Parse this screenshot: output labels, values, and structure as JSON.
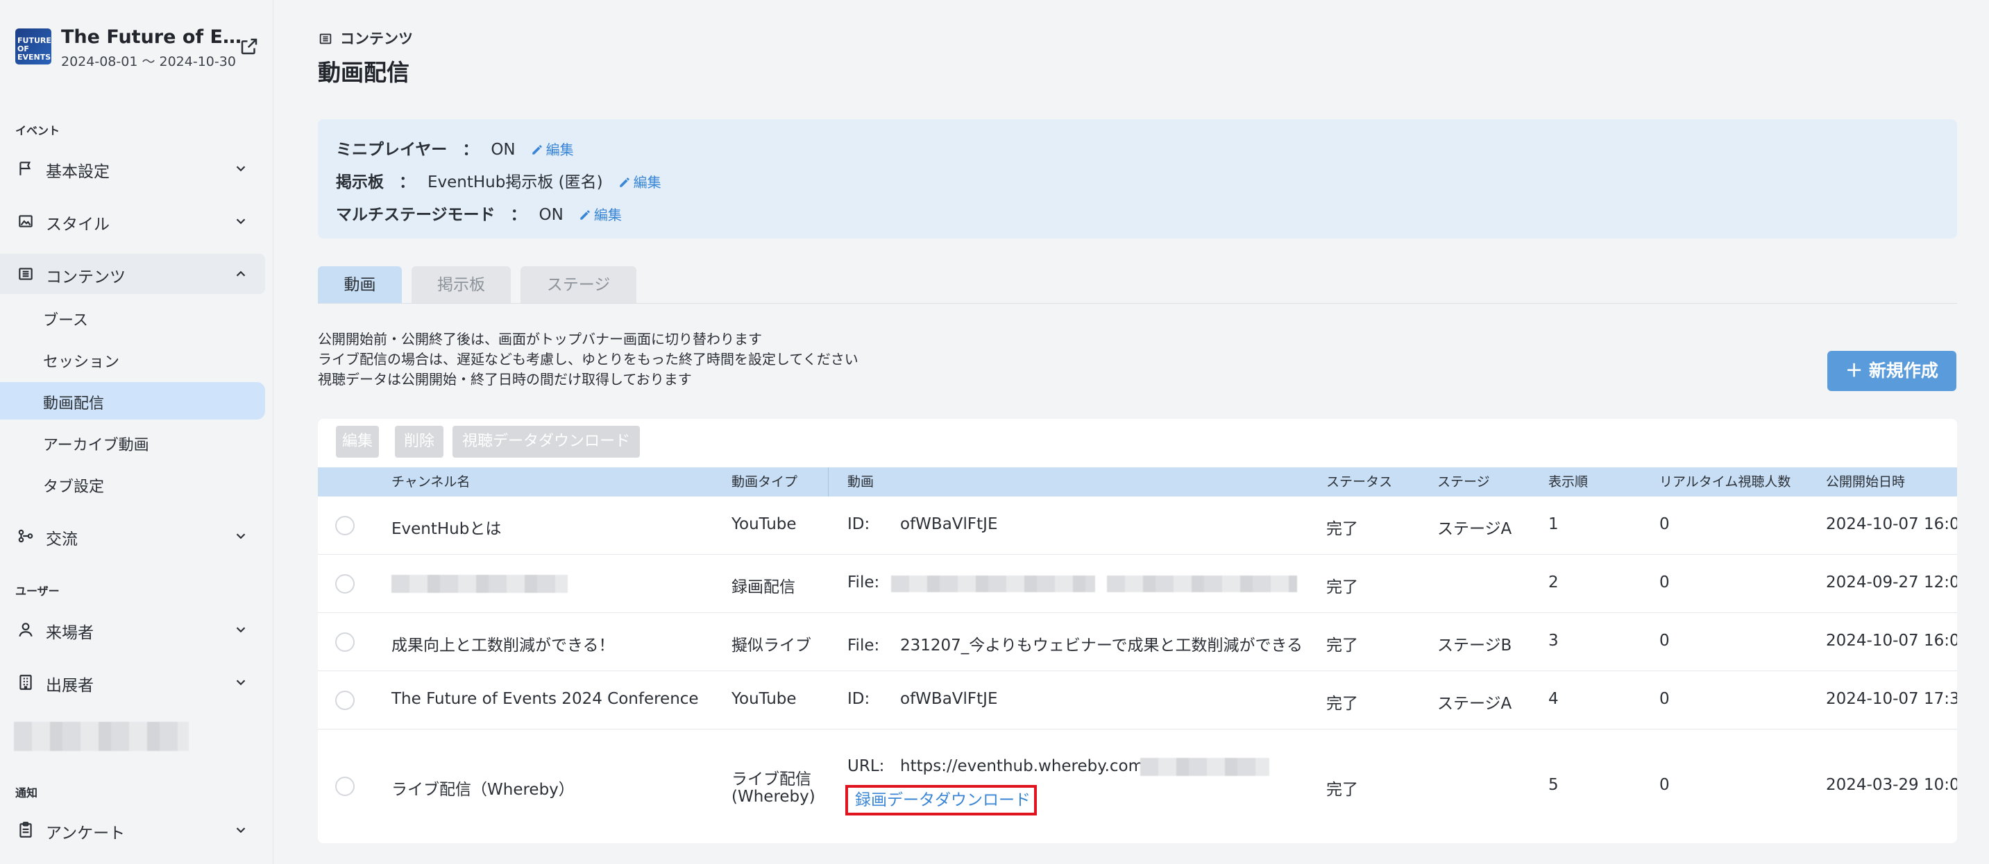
{
  "event": {
    "logo_text": "FUTURE OF EVENTS",
    "title": "The Future of Events 2024 Conference",
    "dates": "2024-08-01 ～ 2024-10-30"
  },
  "sidebar": {
    "section_event": "イベント",
    "section_user": "ユーザー",
    "section_notice": "通知",
    "items": {
      "basic": "基本設定",
      "style": "スタイル",
      "contents": "コンテンツ",
      "exchange": "交流",
      "visitors": "来場者",
      "exhibitors": "出展者",
      "survey": "アンケート"
    },
    "sub_items": [
      "ブース",
      "セッション",
      "動画配信",
      "アーカイブ動画",
      "タブ設定"
    ]
  },
  "breadcrumb": "コンテンツ",
  "page_title": "動画配信",
  "settings": {
    "mini_player": {
      "key": "ミニプレイヤー",
      "colon": "：",
      "value": "ON"
    },
    "board": {
      "key": "掲示板",
      "colon": "：",
      "value": "EventHub掲示板 (匿名)"
    },
    "multistage": {
      "key": "マルチステージモード",
      "colon": "：",
      "value": "ON"
    },
    "edit_label": "編集"
  },
  "tabs": [
    "動画",
    "掲示板",
    "ステージ"
  ],
  "notice": [
    "公開開始前・公開終了後は、画面がトップバナー画面に切り替わります",
    "ライブ配信の場合は、遅延なども考慮し、ゆとりをもった終了時間を設定してください",
    "視聴データは公開開始・終了日時の間だけ取得しております"
  ],
  "new_button": "＋ 新規作成",
  "toolbar": {
    "edit": "編集",
    "delete": "削除",
    "download": "視聴データダウンロード"
  },
  "table": {
    "headers": [
      "チャンネル名",
      "動画タイプ",
      "動画",
      "ステータス",
      "ステージ",
      "表示順",
      "リアルタイム視聴人数",
      "公開開始日時"
    ],
    "rows": [
      {
        "channel": "EventHubとは",
        "type": "YouTube",
        "video_key": "ID:",
        "video_value": "ofWBaVlFtJE",
        "status": "完了",
        "stage": "ステージA",
        "order": "1",
        "viewers": "0",
        "start": "2024-10-07 16:0"
      },
      {
        "channel": "",
        "type": "録画配信",
        "video_key": "File:",
        "video_value": "",
        "status": "完了",
        "stage": "",
        "order": "2",
        "viewers": "0",
        "start": "2024-09-27 12:0"
      },
      {
        "channel": "成果向上と工数削減ができる！",
        "type": "擬似ライブ",
        "video_key": "File:",
        "video_value": "231207_今よりもウェビナーで成果と工数削減ができる",
        "status": "完了",
        "stage": "ステージB",
        "order": "3",
        "viewers": "0",
        "start": "2024-10-07 16:0"
      },
      {
        "channel": "The Future of Events 2024 Conference",
        "type": "YouTube",
        "video_key": "ID:",
        "video_value": "ofWBaVlFtJE",
        "status": "完了",
        "stage": "ステージA",
        "order": "4",
        "viewers": "0",
        "start": "2024-10-07 17:3"
      },
      {
        "channel": "ライブ配信（Whereby）",
        "type_line1": "ライブ配信",
        "type_line2": "(Whereby)",
        "video_key": "URL:",
        "video_value": "https://eventhub.whereby.com/",
        "download_link": "録画データダウンロード",
        "status": "完了",
        "stage": "",
        "order": "5",
        "viewers": "0",
        "start": "2024-03-29 10:0"
      }
    ]
  },
  "colors": {
    "accent": "#3a86d6",
    "highlight_border": "#e0141e",
    "active_nav": "#cfe4fb",
    "header_bg": "#c7def5"
  }
}
